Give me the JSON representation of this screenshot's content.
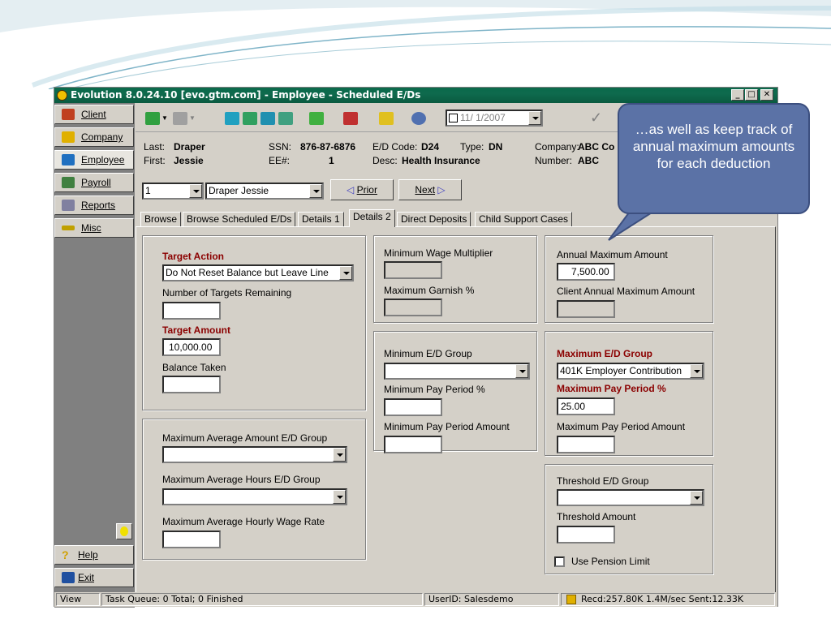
{
  "window": {
    "title": "Evolution 8.0.24.10 [evo.gtm.com] - Employee - Scheduled E/Ds",
    "min_label": "_",
    "max_label": "□",
    "close_label": "✕"
  },
  "nav": {
    "items": [
      {
        "label": "Client",
        "icon": "client-icon",
        "color": "#c04020"
      },
      {
        "label": "Company",
        "icon": "company-icon",
        "color": "#e0b000"
      },
      {
        "label": "Employee",
        "icon": "employee-icon",
        "color": "#2070c0"
      },
      {
        "label": "Payroll",
        "icon": "payroll-icon",
        "color": "#408040"
      },
      {
        "label": "Reports",
        "icon": "reports-icon",
        "color": "#8080a0"
      },
      {
        "label": "Misc",
        "icon": "misc-icon",
        "color": "#c0a000"
      }
    ],
    "help": "Help",
    "exit": "Exit"
  },
  "toolbar": {
    "date": "11/ 1/2007",
    "check": "✓"
  },
  "employee": {
    "last_label": "Last:",
    "last": "Draper",
    "first_label": "First:",
    "first": "Jessie",
    "ssn_label": "SSN:",
    "ssn": "876-87-6876",
    "ee_label": "EE#:",
    "ee": "1",
    "edcode_label": "E/D Code:",
    "edcode": "D24",
    "type_label": "Type:",
    "type": "DN",
    "desc_label": "Desc:",
    "desc": "Health Insurance",
    "company_label": "Company:",
    "company": "ABC Co",
    "number_label": "Number:",
    "number": "ABC"
  },
  "selector": {
    "ee_number": "1",
    "ee_name": "Draper Jessie",
    "prior": "Prior",
    "next": "Next"
  },
  "tabs": [
    "Browse",
    "Browse Scheduled E/Ds",
    "Details 1",
    "Details 2",
    "Direct Deposits",
    "Child Support Cases"
  ],
  "details2": {
    "target_action_label": "Target Action",
    "target_action_value": "Do Not Reset Balance but Leave Line",
    "targets_remaining_label": "Number of Targets Remaining",
    "targets_remaining_value": "",
    "target_amount_label": "Target Amount",
    "target_amount_value": "10,000.00",
    "balance_taken_label": "Balance Taken",
    "balance_taken_value": "",
    "max_avg_amount_label": "Maximum Average Amount E/D Group",
    "max_avg_amount_value": "",
    "max_avg_hours_label": "Maximum Average Hours E/D Group",
    "max_avg_hours_value": "",
    "max_avg_rate_label": "Maximum Average Hourly Wage Rate",
    "max_avg_rate_value": "",
    "min_wage_mult_label": "Minimum Wage Multiplier",
    "min_wage_mult_value": "",
    "max_garnish_label": "Maximum Garnish %",
    "max_garnish_value": "",
    "min_ed_group_label": "Minimum E/D Group",
    "min_ed_group_value": "",
    "min_pay_period_pct_label": "Minimum Pay Period %",
    "min_pay_period_pct_value": "",
    "min_pay_period_amt_label": "Minimum Pay Period Amount",
    "min_pay_period_amt_value": "",
    "annual_max_label": "Annual Maximum Amount",
    "annual_max_value": "7,500.00",
    "client_annual_max_label": "Client Annual Maximum Amount",
    "client_annual_max_value": "",
    "max_ed_group_label": "Maximum E/D Group",
    "max_ed_group_value": "401K Employer Contribution",
    "max_pay_period_pct_label": "Maximum Pay Period %",
    "max_pay_period_pct_value": "25.00",
    "max_pay_period_amt_label": "Maximum Pay Period Amount",
    "max_pay_period_amt_value": "",
    "threshold_group_label": "Threshold E/D Group",
    "threshold_group_value": "",
    "threshold_amount_label": "Threshold Amount",
    "threshold_amount_value": "",
    "pension_limit_label": "Use Pension Limit"
  },
  "status": {
    "view": "View",
    "queue": "Task Queue: 0 Total; 0 Finished",
    "user": "UserID: Salesdemo",
    "stats": "Recd:257.80K  1.4M/sec  Sent:12.33K"
  },
  "callout": {
    "text": "…as well as keep track of annual maximum amounts for each deduction"
  },
  "colors": {
    "title_bar": "#0e6a4d",
    "required_label": "#8b0000",
    "callout_fill": "#5b72a6"
  }
}
